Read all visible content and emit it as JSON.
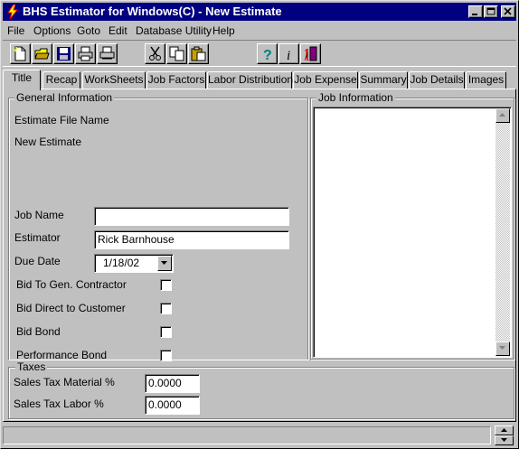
{
  "window": {
    "title": "BHS Estimator for Windows(C) - New Estimate",
    "accent_color": "#000080"
  },
  "menu": {
    "items": [
      {
        "label": "File"
      },
      {
        "label": "Options"
      },
      {
        "label": "Goto"
      },
      {
        "label": "Edit"
      },
      {
        "label": "Database Utility"
      },
      {
        "label": "Help"
      }
    ]
  },
  "toolbar": {
    "icons": [
      "new-document-icon",
      "open-folder-icon",
      "save-disk-icon",
      "print-icon",
      "print-preview-icon",
      "cut-scissors-icon",
      "copy-icon",
      "paste-icon",
      "help-question-icon",
      "info-icon",
      "exit-door-icon"
    ]
  },
  "tabs": [
    {
      "label": "Title",
      "active": true
    },
    {
      "label": "Recap"
    },
    {
      "label": "WorkSheets"
    },
    {
      "label": "Job Factors"
    },
    {
      "label": "Labor Distribution"
    },
    {
      "label": "Job Expense"
    },
    {
      "label": "Summary"
    },
    {
      "label": "Job Details"
    },
    {
      "label": "Images"
    }
  ],
  "general": {
    "group_label": "General Information",
    "file_name_label": "Estimate File Name",
    "file_name_value": "New Estimate",
    "job_name_label": "Job Name",
    "job_name_value": "",
    "estimator_label": "Estimator",
    "estimator_value": "Rick Barnhouse",
    "due_date_label": "Due Date",
    "due_date_value": "1/18/02",
    "bid_gen_contractor_label": "Bid To Gen. Contractor",
    "bid_direct_label": "Bid Direct to Customer",
    "bid_bond_label": "Bid Bond",
    "performance_bond_label": "Performance Bond"
  },
  "job_info": {
    "group_label": "Job Information",
    "text": ""
  },
  "taxes": {
    "group_label": "Taxes",
    "material_label": "Sales Tax Material %",
    "material_value": "0.0000",
    "labor_label": "Sales Tax Labor %",
    "labor_value": "0.0000"
  },
  "statusbar": {
    "text": ""
  }
}
